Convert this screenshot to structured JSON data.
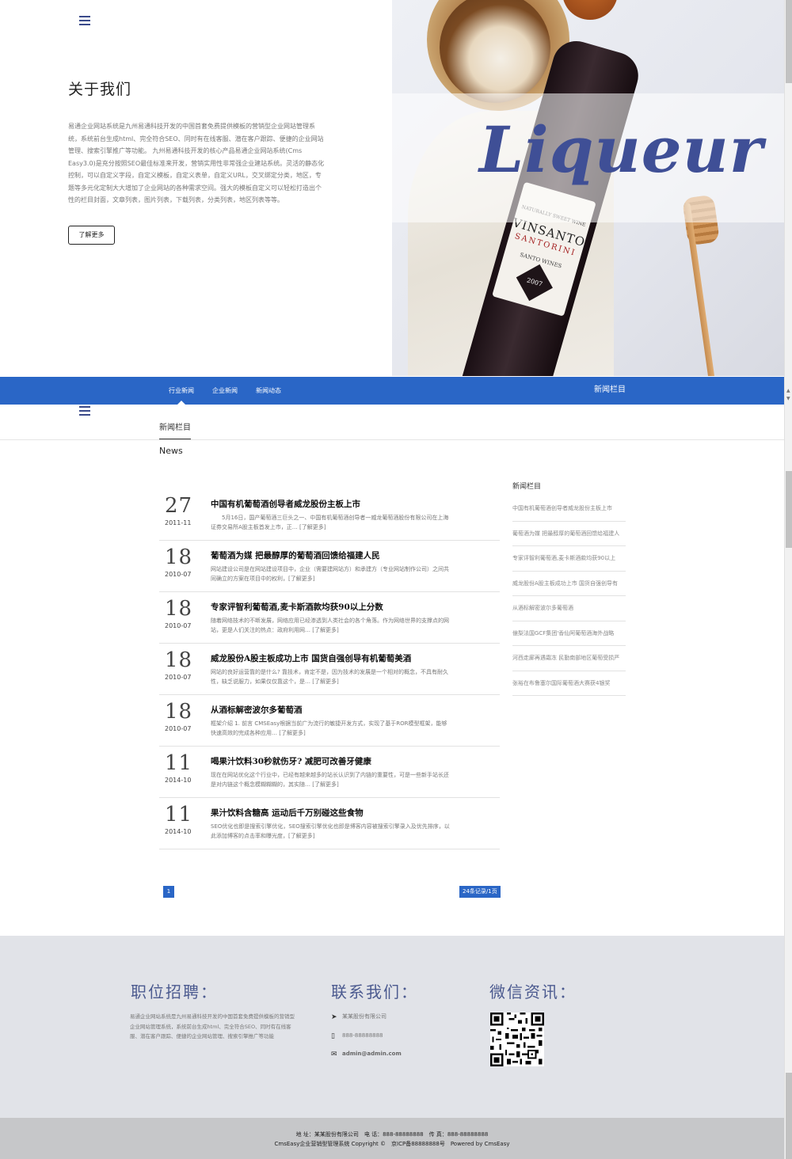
{
  "hero": {
    "menu_icon": "hamburger-icon",
    "about_title": "关于我们",
    "about_text": "易通企业网站系统是九州易通科技开发的中国首套免费提供模板的营销型企业网站管理系统，系统前台生成html、完全符合SEO、同时有在线客服、潜在客户跟踪、便捷的企业网站管理、搜索引擎推广等功能。 九州易通科技开发的核心产品易通企业网站系统(Cms Easy3.0)是充分按照SEO最佳标准来开发，营销实用性非常强企业建站系统。灵活的静态化控制，可以自定义字段，自定义模板，自定义表单，自定义URL，交叉绑定分类，地区，专题等多元化定制大大增加了企业网站的各种需求空间。强大的模板自定义可以轻松打造出个性的栏目封面，文章列表，图片列表，下载列表，分类列表，地区列表等等。",
    "more_button": "了解更多",
    "banner_word": "Liqueur",
    "bottle": {
      "line1": "NATURALLY SWEET WINE",
      "brand": "VINSANTO",
      "region": "SANTORINI",
      "line4": "SANTO WINES",
      "year": "2007"
    }
  },
  "nav": {
    "tabs": [
      "行业新闻",
      "企业新闻",
      "新闻动态"
    ],
    "right_title": "新闻栏目"
  },
  "section": {
    "title": "新闻栏目",
    "en_title": "News"
  },
  "news": [
    {
      "day": "27",
      "date": "2011-11",
      "title": "中国有机葡萄酒创导者威龙股份主板上市",
      "desc": "　　5月16日，国产葡萄酒三巨头之一、中国有机葡萄酒创导者一威龙葡萄酒股份有限公司在上海证券交易所A股主板首发上市，正… [了解更多]"
    },
    {
      "day": "18",
      "date": "2010-07",
      "title": "葡萄酒为媒 把最醇厚的葡萄酒回馈给福建人民",
      "desc": "网站建设公司是在网站建设项目中，企业（需要建网站方）和承建方（专业网站制作公司）之间共同确立的方案在项目中的权利，[了解更多]"
    },
    {
      "day": "18",
      "date": "2010-07",
      "title": "专家评智利葡萄酒,麦卡斯酒款均获90以上分数",
      "desc": "随着网络技术的不断发展，网络应用已经渗透到人类社会的各个角落。作为网络世界的支撑点的网站，更是人们关注的热点：政府利用网… [了解更多]"
    },
    {
      "day": "18",
      "date": "2010-07",
      "title": "威龙股份A股主板成功上市 国货自强创导有机葡萄美酒",
      "desc": "网站的良好运营靠的是什么? 靠技术，肯定不是，因为技术的发展是一个相对的概念，不具有耐久性，缺乏说服力，如果仅仅靠这个，是… [了解更多]"
    },
    {
      "day": "18",
      "date": "2010-07",
      "title": "从酒标解密波尔多葡萄酒",
      "desc": "框架介绍 1. 前言 CMSEasy根据当前广为流行的敏捷开发方式，实现了基于ROR模型框架，能够快速高效的完成各种应用… [了解更多]"
    },
    {
      "day": "11",
      "date": "2014-10",
      "title": "喝果汁饮料30秒就伤牙? 减肥可改善牙健康",
      "desc": "现在在网站优化这个行业中，已经有越来越多的站长认识到了内链的重要性，可是一些新手站长还是对内链这个概念模糊糊糊的，其实随… [了解更多]"
    },
    {
      "day": "11",
      "date": "2014-10",
      "title": "果汁饮料含糖高 运动后千万别碰这些食物",
      "desc": "SEO优化也即是搜索引擎优化，SEO搜索引擎优化也即是博客内容被搜索引擎录入及优先排序，以此添加博客的点击率和曝光度，[了解更多]"
    }
  ],
  "pagination": {
    "current": "1",
    "info": "24条记录/1页"
  },
  "sidebar": {
    "title": "新闻栏目",
    "items": [
      "中国有机葡萄酒创导者威龙股份主板上市",
      "葡萄酒为媒 把最醇厚的葡萄酒回馈给福建人",
      "专家评智利葡萄酒,麦卡斯酒款均获90以上",
      "威龙股份A股主板成功上市 国货自强创导有",
      "从酒标解密波尔多葡萄酒",
      "億梨法国GCF集团'香仙阿葡萄酒海外战略",
      "河西走廊再遇霜冻 民勤南部地区葡萄受损严",
      "张裕在布鲁塞尔国际葡萄酒大赛获4银奖"
    ]
  },
  "footer": {
    "jobs_title": "职位招聘：",
    "jobs_text": "易通企业网站系统是九州易通科技开发的中国首套免费提供模板的营销型企业网站管理系统，系统前台生成html、完全符合SEO、同时有在线客服、潜在客户跟踪、便捷的企业网站管理、搜索引擎推广等功能",
    "contact_title": "联系我们：",
    "company": "某某股份有限公司",
    "phone": "888-88888888",
    "email": "admin@admin.com",
    "wechat_title": "微信资讯：",
    "icons": {
      "address": "paper-plane-icon",
      "phone": "mobile-phone-icon",
      "email": "envelope-icon"
    }
  },
  "bottom": {
    "line1": "地 址：某某股份有限公司　电 话：888-88888888　传 真：888-88888888",
    "line2": "CmsEasy企业营销型管理系统 Copyright ©　京ICP备88888888号　Powered by CmsEasy"
  },
  "colors": {
    "accent": "#2a66c6",
    "footer_heading": "#4b5a8f",
    "footer_bg": "#e1e3e8",
    "bottom_bg": "#c6c7c9"
  }
}
